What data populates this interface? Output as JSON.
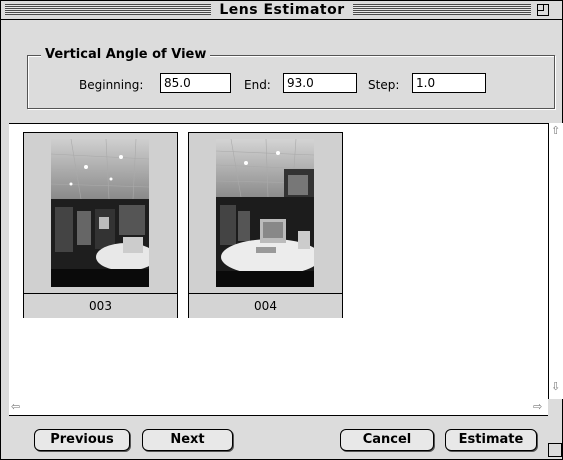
{
  "window": {
    "title": "Lens Estimator"
  },
  "angle_group": {
    "title": "Vertical Angle of View",
    "beginning_label": "Beginning:",
    "beginning_value": "85.0",
    "end_label": "End:",
    "end_value": "93.0",
    "step_label": "Step:",
    "step_value": "1.0"
  },
  "thumbnails": [
    {
      "caption": "003"
    },
    {
      "caption": "004"
    }
  ],
  "buttons": {
    "previous": "Previous",
    "next": "Next",
    "cancel": "Cancel",
    "estimate": "Estimate"
  }
}
